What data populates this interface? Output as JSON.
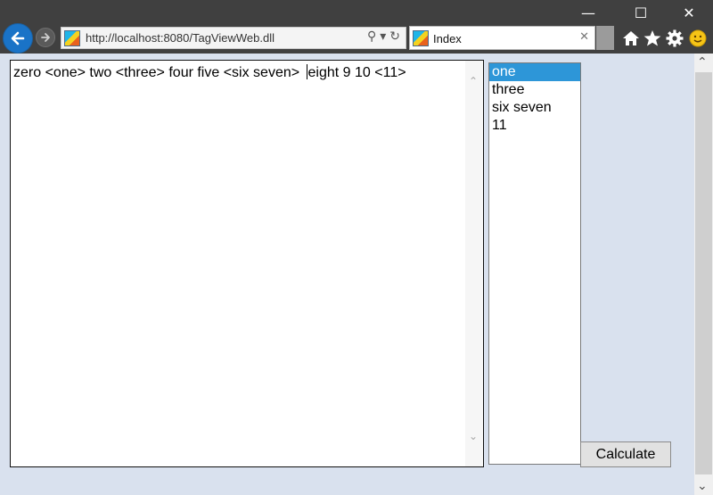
{
  "window": {
    "controls": {
      "minimize": "—",
      "maximize": "☐",
      "close": "✕"
    }
  },
  "nav": {
    "back_icon": "back-arrow-icon",
    "forward_icon": "forward-arrow-icon"
  },
  "address": {
    "url": "http://localhost:8080/TagViewWeb.dll",
    "search_glyph": "⚲",
    "dropdown_glyph": "▾",
    "refresh_glyph": "↻"
  },
  "tab": {
    "title": "Index",
    "close": "✕"
  },
  "toolbar": {
    "icons": [
      "home-icon",
      "star-icon",
      "gear-icon",
      "smiley-icon"
    ]
  },
  "editor": {
    "text_before_caret": "zero <one> two <three> four five <six seven> ",
    "text_after_caret": "eight 9 10 <11>",
    "scroll_up": "⌃",
    "scroll_down": "⌄"
  },
  "list": {
    "items": [
      "one",
      "three",
      "six seven",
      "11"
    ],
    "selected_index": 0
  },
  "calculate_button": {
    "label": "Calculate"
  },
  "page_scroll": {
    "up": "⌃",
    "down": "⌄"
  },
  "colors": {
    "titlebar": "#404040",
    "page_background": "#d9e1ee",
    "selection": "#2d96d8",
    "back_button": "#1a73c7"
  }
}
